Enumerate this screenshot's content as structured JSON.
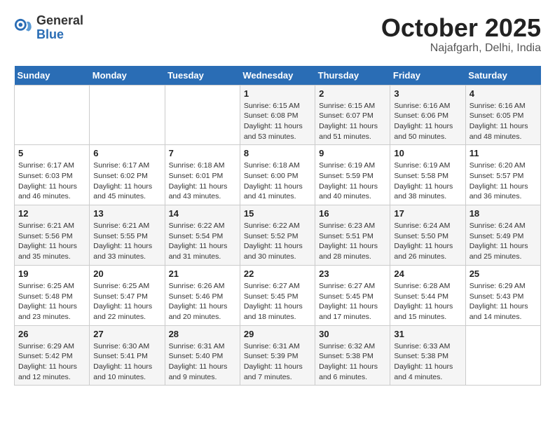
{
  "logo": {
    "general": "General",
    "blue": "Blue"
  },
  "title": "October 2025",
  "subtitle": "Najafgarh, Delhi, India",
  "days_of_week": [
    "Sunday",
    "Monday",
    "Tuesday",
    "Wednesday",
    "Thursday",
    "Friday",
    "Saturday"
  ],
  "weeks": [
    [
      {
        "day": "",
        "info": ""
      },
      {
        "day": "",
        "info": ""
      },
      {
        "day": "",
        "info": ""
      },
      {
        "day": "1",
        "info": "Sunrise: 6:15 AM\nSunset: 6:08 PM\nDaylight: 11 hours\nand 53 minutes."
      },
      {
        "day": "2",
        "info": "Sunrise: 6:15 AM\nSunset: 6:07 PM\nDaylight: 11 hours\nand 51 minutes."
      },
      {
        "day": "3",
        "info": "Sunrise: 6:16 AM\nSunset: 6:06 PM\nDaylight: 11 hours\nand 50 minutes."
      },
      {
        "day": "4",
        "info": "Sunrise: 6:16 AM\nSunset: 6:05 PM\nDaylight: 11 hours\nand 48 minutes."
      }
    ],
    [
      {
        "day": "5",
        "info": "Sunrise: 6:17 AM\nSunset: 6:03 PM\nDaylight: 11 hours\nand 46 minutes."
      },
      {
        "day": "6",
        "info": "Sunrise: 6:17 AM\nSunset: 6:02 PM\nDaylight: 11 hours\nand 45 minutes."
      },
      {
        "day": "7",
        "info": "Sunrise: 6:18 AM\nSunset: 6:01 PM\nDaylight: 11 hours\nand 43 minutes."
      },
      {
        "day": "8",
        "info": "Sunrise: 6:18 AM\nSunset: 6:00 PM\nDaylight: 11 hours\nand 41 minutes."
      },
      {
        "day": "9",
        "info": "Sunrise: 6:19 AM\nSunset: 5:59 PM\nDaylight: 11 hours\nand 40 minutes."
      },
      {
        "day": "10",
        "info": "Sunrise: 6:19 AM\nSunset: 5:58 PM\nDaylight: 11 hours\nand 38 minutes."
      },
      {
        "day": "11",
        "info": "Sunrise: 6:20 AM\nSunset: 5:57 PM\nDaylight: 11 hours\nand 36 minutes."
      }
    ],
    [
      {
        "day": "12",
        "info": "Sunrise: 6:21 AM\nSunset: 5:56 PM\nDaylight: 11 hours\nand 35 minutes."
      },
      {
        "day": "13",
        "info": "Sunrise: 6:21 AM\nSunset: 5:55 PM\nDaylight: 11 hours\nand 33 minutes."
      },
      {
        "day": "14",
        "info": "Sunrise: 6:22 AM\nSunset: 5:54 PM\nDaylight: 11 hours\nand 31 minutes."
      },
      {
        "day": "15",
        "info": "Sunrise: 6:22 AM\nSunset: 5:52 PM\nDaylight: 11 hours\nand 30 minutes."
      },
      {
        "day": "16",
        "info": "Sunrise: 6:23 AM\nSunset: 5:51 PM\nDaylight: 11 hours\nand 28 minutes."
      },
      {
        "day": "17",
        "info": "Sunrise: 6:24 AM\nSunset: 5:50 PM\nDaylight: 11 hours\nand 26 minutes."
      },
      {
        "day": "18",
        "info": "Sunrise: 6:24 AM\nSunset: 5:49 PM\nDaylight: 11 hours\nand 25 minutes."
      }
    ],
    [
      {
        "day": "19",
        "info": "Sunrise: 6:25 AM\nSunset: 5:48 PM\nDaylight: 11 hours\nand 23 minutes."
      },
      {
        "day": "20",
        "info": "Sunrise: 6:25 AM\nSunset: 5:47 PM\nDaylight: 11 hours\nand 22 minutes."
      },
      {
        "day": "21",
        "info": "Sunrise: 6:26 AM\nSunset: 5:46 PM\nDaylight: 11 hours\nand 20 minutes."
      },
      {
        "day": "22",
        "info": "Sunrise: 6:27 AM\nSunset: 5:45 PM\nDaylight: 11 hours\nand 18 minutes."
      },
      {
        "day": "23",
        "info": "Sunrise: 6:27 AM\nSunset: 5:45 PM\nDaylight: 11 hours\nand 17 minutes."
      },
      {
        "day": "24",
        "info": "Sunrise: 6:28 AM\nSunset: 5:44 PM\nDaylight: 11 hours\nand 15 minutes."
      },
      {
        "day": "25",
        "info": "Sunrise: 6:29 AM\nSunset: 5:43 PM\nDaylight: 11 hours\nand 14 minutes."
      }
    ],
    [
      {
        "day": "26",
        "info": "Sunrise: 6:29 AM\nSunset: 5:42 PM\nDaylight: 11 hours\nand 12 minutes."
      },
      {
        "day": "27",
        "info": "Sunrise: 6:30 AM\nSunset: 5:41 PM\nDaylight: 11 hours\nand 10 minutes."
      },
      {
        "day": "28",
        "info": "Sunrise: 6:31 AM\nSunset: 5:40 PM\nDaylight: 11 hours\nand 9 minutes."
      },
      {
        "day": "29",
        "info": "Sunrise: 6:31 AM\nSunset: 5:39 PM\nDaylight: 11 hours\nand 7 minutes."
      },
      {
        "day": "30",
        "info": "Sunrise: 6:32 AM\nSunset: 5:38 PM\nDaylight: 11 hours\nand 6 minutes."
      },
      {
        "day": "31",
        "info": "Sunrise: 6:33 AM\nSunset: 5:38 PM\nDaylight: 11 hours\nand 4 minutes."
      },
      {
        "day": "",
        "info": ""
      }
    ]
  ]
}
